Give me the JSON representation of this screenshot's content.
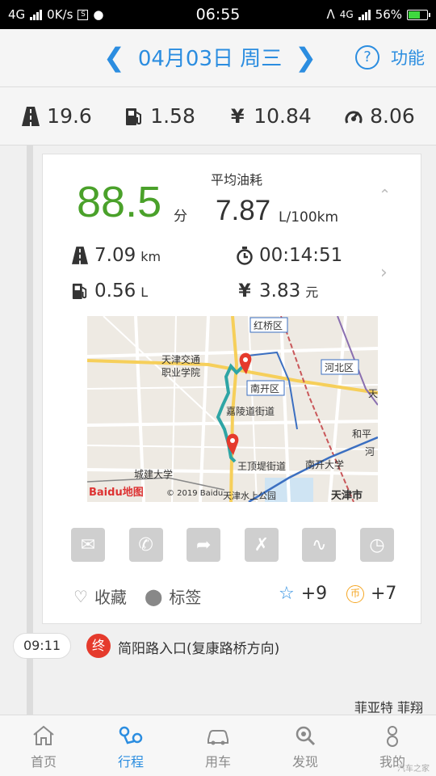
{
  "status_bar": {
    "network_left": "4G",
    "speed": "0K/s",
    "sim_icon": "S",
    "time": "06:55",
    "network_right": "4G",
    "battery": "56%"
  },
  "header": {
    "prev_icon": "chevron-left-icon",
    "date": "04月03日 周三",
    "next_icon": "chevron-right-icon",
    "help_icon": "?",
    "func_label": "功能"
  },
  "summary": {
    "distance": "19.6",
    "fuel": "1.58",
    "cost": "10.84",
    "avg": "8.06"
  },
  "trip": {
    "score": "88.5",
    "score_unit": "分",
    "avg_label": "平均油耗",
    "avg_value": "7.87",
    "avg_unit": "L/100km",
    "distance": "7.09",
    "distance_unit": "km",
    "duration": "00:14:51",
    "fuel": "0.56",
    "fuel_unit": "L",
    "cost": "3.83",
    "cost_unit": "元"
  },
  "map": {
    "labels": {
      "hongqiao": "红桥区",
      "hebei": "河北区",
      "nankai": "南开区",
      "jialing": "嘉陵道街道",
      "wangding": "王顶堤街道",
      "nankai_univ": "南开大学",
      "heping": "和平",
      "he": "河",
      "tian": "天",
      "tj_jiaotong": "天津交通",
      "tj_zhiye": "职业学院",
      "chengjian": "城建大学",
      "shuishang": "天津水上公园",
      "tianjin": "天津市",
      "baidu_logo": "Baidu地图",
      "copyright": "© 2019 Baidu"
    }
  },
  "actions": [
    "mail-icon",
    "phone-icon",
    "share-icon",
    "no-phone-icon",
    "route-icon",
    "speed-icon"
  ],
  "social": {
    "fav_label": "收藏",
    "tag_label": "标签",
    "star_value": "+9",
    "coin_label": "币",
    "coin_value": "+7"
  },
  "end_point": {
    "time": "09:11",
    "badge": "终",
    "address": "简阳路入口(复康路桥方向)"
  },
  "car_model": "菲亚特 菲翔",
  "bottom_nav": [
    {
      "label": "首页"
    },
    {
      "label": "行程"
    },
    {
      "label": "用车"
    },
    {
      "label": "发现"
    },
    {
      "label": "我的"
    }
  ],
  "watermark": "汽车之家",
  "colors": {
    "accent": "#2b8de0",
    "score": "#4aa12a",
    "end_badge": "#e53a2c",
    "coin": "#f5a623"
  }
}
